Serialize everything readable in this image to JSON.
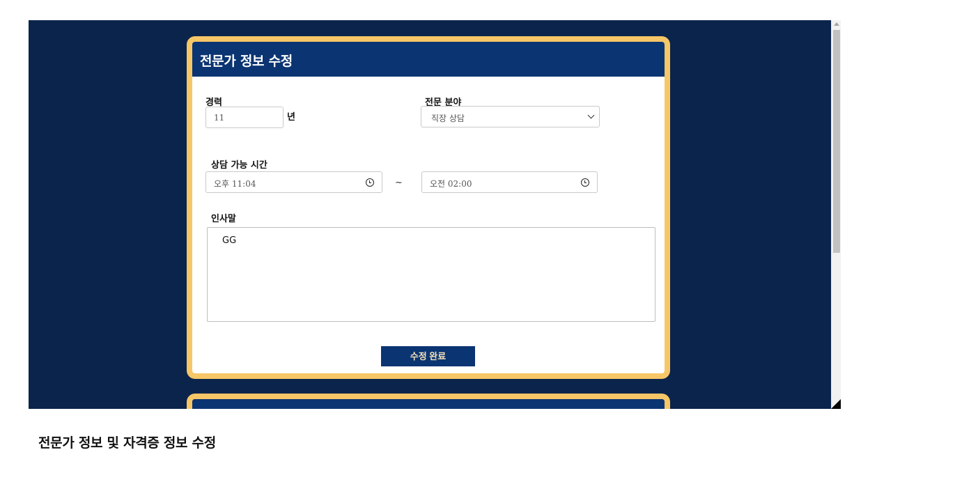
{
  "form": {
    "title": "전문가 정보 수정",
    "career_label": "경력",
    "career_value": "11",
    "career_unit": "년",
    "field_label": "전문 분야",
    "field_value": "직장 상담",
    "hours_label": "상담 가능 시간",
    "start_time": "오후 11:04",
    "range_separator": "~",
    "end_time": "오전 02:00",
    "greeting_label": "인사말",
    "greeting_value": "GG",
    "submit_label": "수정 완료"
  },
  "caption": "전문가 정보 및 자격증 정보 수정",
  "colors": {
    "page_background": "#0b244b",
    "header_background": "#0b3472",
    "card_border": "#f6c667",
    "button_text": "#f3e2b8"
  },
  "icons": {
    "select_arrow": "chevron-down-icon",
    "time_picker": "clock-icon"
  }
}
